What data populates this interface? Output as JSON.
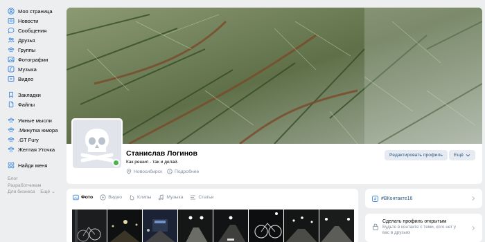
{
  "sidebar": {
    "items": [
      {
        "label": "Моя страница",
        "icon": "user-circle-icon"
      },
      {
        "label": "Новости",
        "icon": "news-icon"
      },
      {
        "label": "Сообщения",
        "icon": "message-icon"
      },
      {
        "label": "Друзья",
        "icon": "friends-icon"
      },
      {
        "label": "Группы",
        "icon": "groups-icon"
      },
      {
        "label": "Фотографии",
        "icon": "photo-icon"
      },
      {
        "label": "Музыка",
        "icon": "music-icon"
      },
      {
        "label": "Видео",
        "icon": "video-icon"
      }
    ],
    "items2": [
      {
        "label": "Закладки",
        "icon": "bookmark-icon"
      },
      {
        "label": "Файлы",
        "icon": "file-icon"
      }
    ],
    "groups": [
      {
        "label": "Умные мысли",
        "icon": "groups-icon"
      },
      {
        "label": ".Минутка юмора",
        "icon": "groups-icon"
      },
      {
        "label": ".GT Fury",
        "icon": "groups-icon"
      },
      {
        "label": "Желтая Уточка",
        "icon": "groups-icon"
      }
    ],
    "find": {
      "label": "Найди меня",
      "icon": "apps-icon"
    },
    "footer": {
      "blog": "Блог",
      "developers": "Разработчикам",
      "business": "Для бизнеса",
      "more": "Ещё"
    }
  },
  "profile": {
    "name": "Станислав Логинов",
    "status": "Как решил - так и делай.",
    "city": "Новосибирск",
    "details": "Подробнее",
    "edit_button": "Редактировать профиль",
    "more_button": "Ещё",
    "online": true
  },
  "media": {
    "tabs": [
      {
        "label": "Фото",
        "icon": "photo-tab-icon",
        "active": true
      },
      {
        "label": "Видео",
        "icon": "video-tab-icon",
        "active": false
      },
      {
        "label": "Клипы",
        "icon": "clips-tab-icon",
        "active": false
      },
      {
        "label": "Музыка",
        "icon": "music-tab-icon",
        "active": false
      },
      {
        "label": "Статьи",
        "icon": "articles-tab-icon",
        "active": false
      }
    ],
    "photo_count": 8
  },
  "right": {
    "hashtag": "#ВКонтакте16",
    "open_profile_title": "Сделать профиль открытым",
    "open_profile_sub": "Будьте в контакте с теми, кого нет у вас в друзьях"
  },
  "colors": {
    "accent": "#2a5885",
    "online": "#4bb34b",
    "muted": "#818c99",
    "icon": "#3f8ae0"
  }
}
